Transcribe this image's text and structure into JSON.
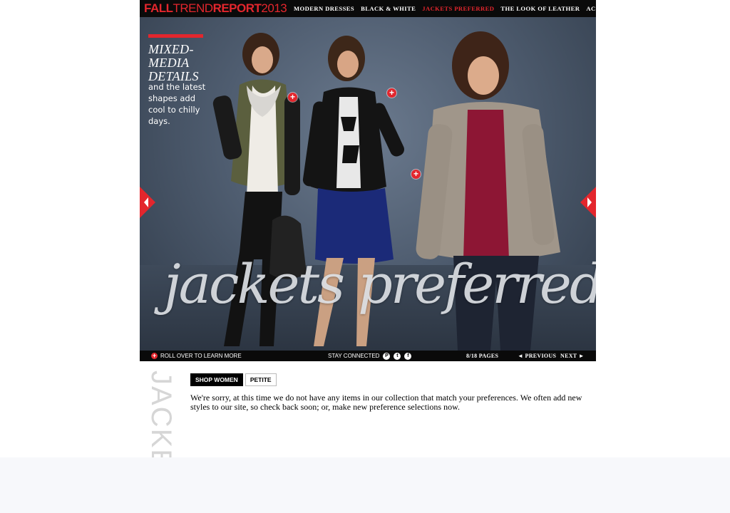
{
  "brand": {
    "part1": "FALL",
    "part2": "TREND",
    "part3": "REPORT",
    "part4": "2013"
  },
  "nav": {
    "items": [
      {
        "label": "Modern Dresses",
        "active": false
      },
      {
        "label": "Black & White",
        "active": false
      },
      {
        "label": "Jackets Preferred",
        "active": true
      },
      {
        "label": "The Look of Leather",
        "active": false
      },
      {
        "label": "Accessories",
        "active": false
      }
    ]
  },
  "hero": {
    "headline": "Mixed-Media Details",
    "subhead": "and the latest shapes add cool to chilly days.",
    "title": "jackets preferred"
  },
  "bottombar": {
    "roll_over": "ROLL OVER TO LEARN MORE",
    "stay_connected": "STAY CONNECTED",
    "pages": "8/18 PAGES",
    "previous": "◄ PREVIOUS",
    "next": "NEXT ►",
    "social": [
      {
        "icon": "pinterest-icon",
        "glyph": "P"
      },
      {
        "icon": "twitter-icon",
        "glyph": "t"
      },
      {
        "icon": "facebook-icon",
        "glyph": "f"
      }
    ]
  },
  "section": {
    "vertical_word": "JACKE",
    "tabs": [
      {
        "label": "SHOP WOMEN",
        "active": true
      },
      {
        "label": "PETITE",
        "active": false
      }
    ],
    "notice": "We're sorry, at this time we do not have any items in our collection that match your preferences. We often add new styles to our site, so check back soon; or, make new preference selections now."
  },
  "colors": {
    "accent": "#e3262d",
    "bar": "#0a0a0a",
    "background": "#ffffff"
  }
}
